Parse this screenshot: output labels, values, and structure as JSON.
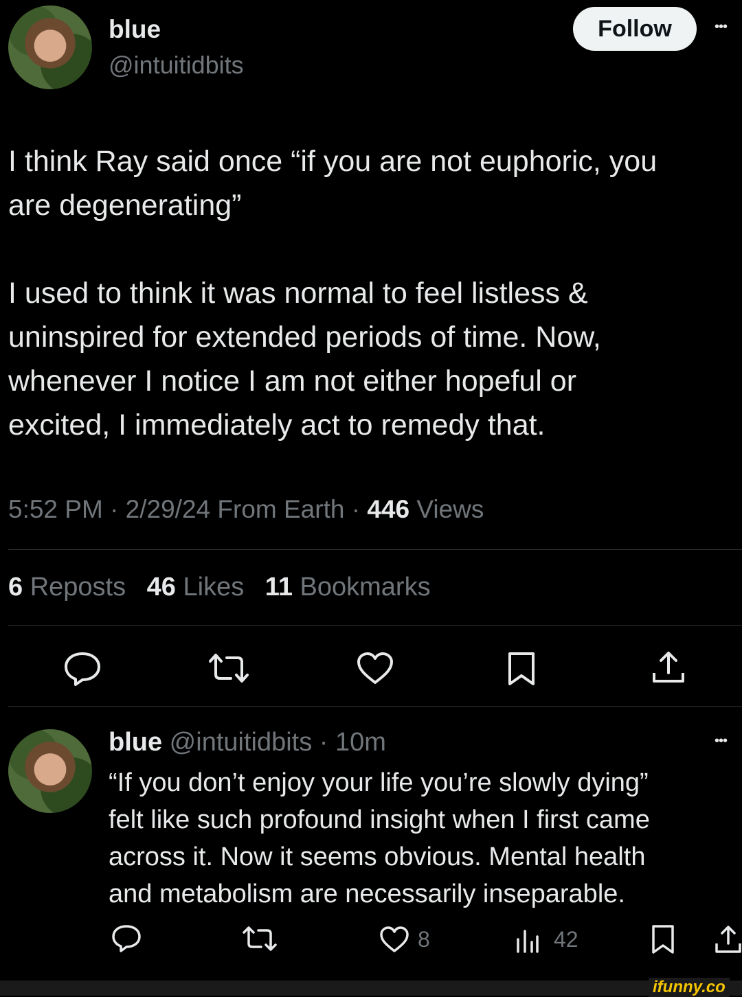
{
  "main_tweet": {
    "display_name": "blue",
    "handle": "@intuitidbits",
    "follow_label": "Follow",
    "more_label": "•••",
    "paragraph1_line1": "I think Ray said once “if you are not euphoric, you",
    "paragraph1_line2": "are degenerating”",
    "paragraph2_line1": "I used to think it was normal to feel listless &",
    "paragraph2_line2": "uninspired for extended periods of time. Now,",
    "paragraph2_line3": "whenever I notice I am not either hopeful or",
    "paragraph2_line4": "excited, I immediately act to remedy that.",
    "timestamp": "5:52 PM · 2/29/24 From Earth · ",
    "views_count": "446",
    "views_label": " Views",
    "stats": {
      "reposts_count": "6",
      "reposts_label": " Reposts",
      "likes_count": "46",
      "likes_label": " Likes",
      "bookmarks_count": "11",
      "bookmarks_label": " Bookmarks"
    }
  },
  "reply": {
    "display_name": "blue",
    "handle_time": " @intuitidbits · 10m",
    "more_label": "•••",
    "line1": "“If you don’t enjoy your life you’re slowly dying”",
    "line2": "felt like such profound insight when I first came",
    "line3": "across it. Now it seems obvious. Mental health",
    "line4": "and metabolism are necessarily inseparable.",
    "likes": "8",
    "views": "42"
  },
  "watermark": "ifunny.co",
  "icons": [
    "reply-icon",
    "repost-icon",
    "like-icon",
    "bookmark-icon",
    "share-icon",
    "views-icon"
  ],
  "colors": {
    "background": "#000000",
    "text": "#e7e9ea",
    "muted": "#71767b",
    "follow_bg": "#eff3f4"
  }
}
